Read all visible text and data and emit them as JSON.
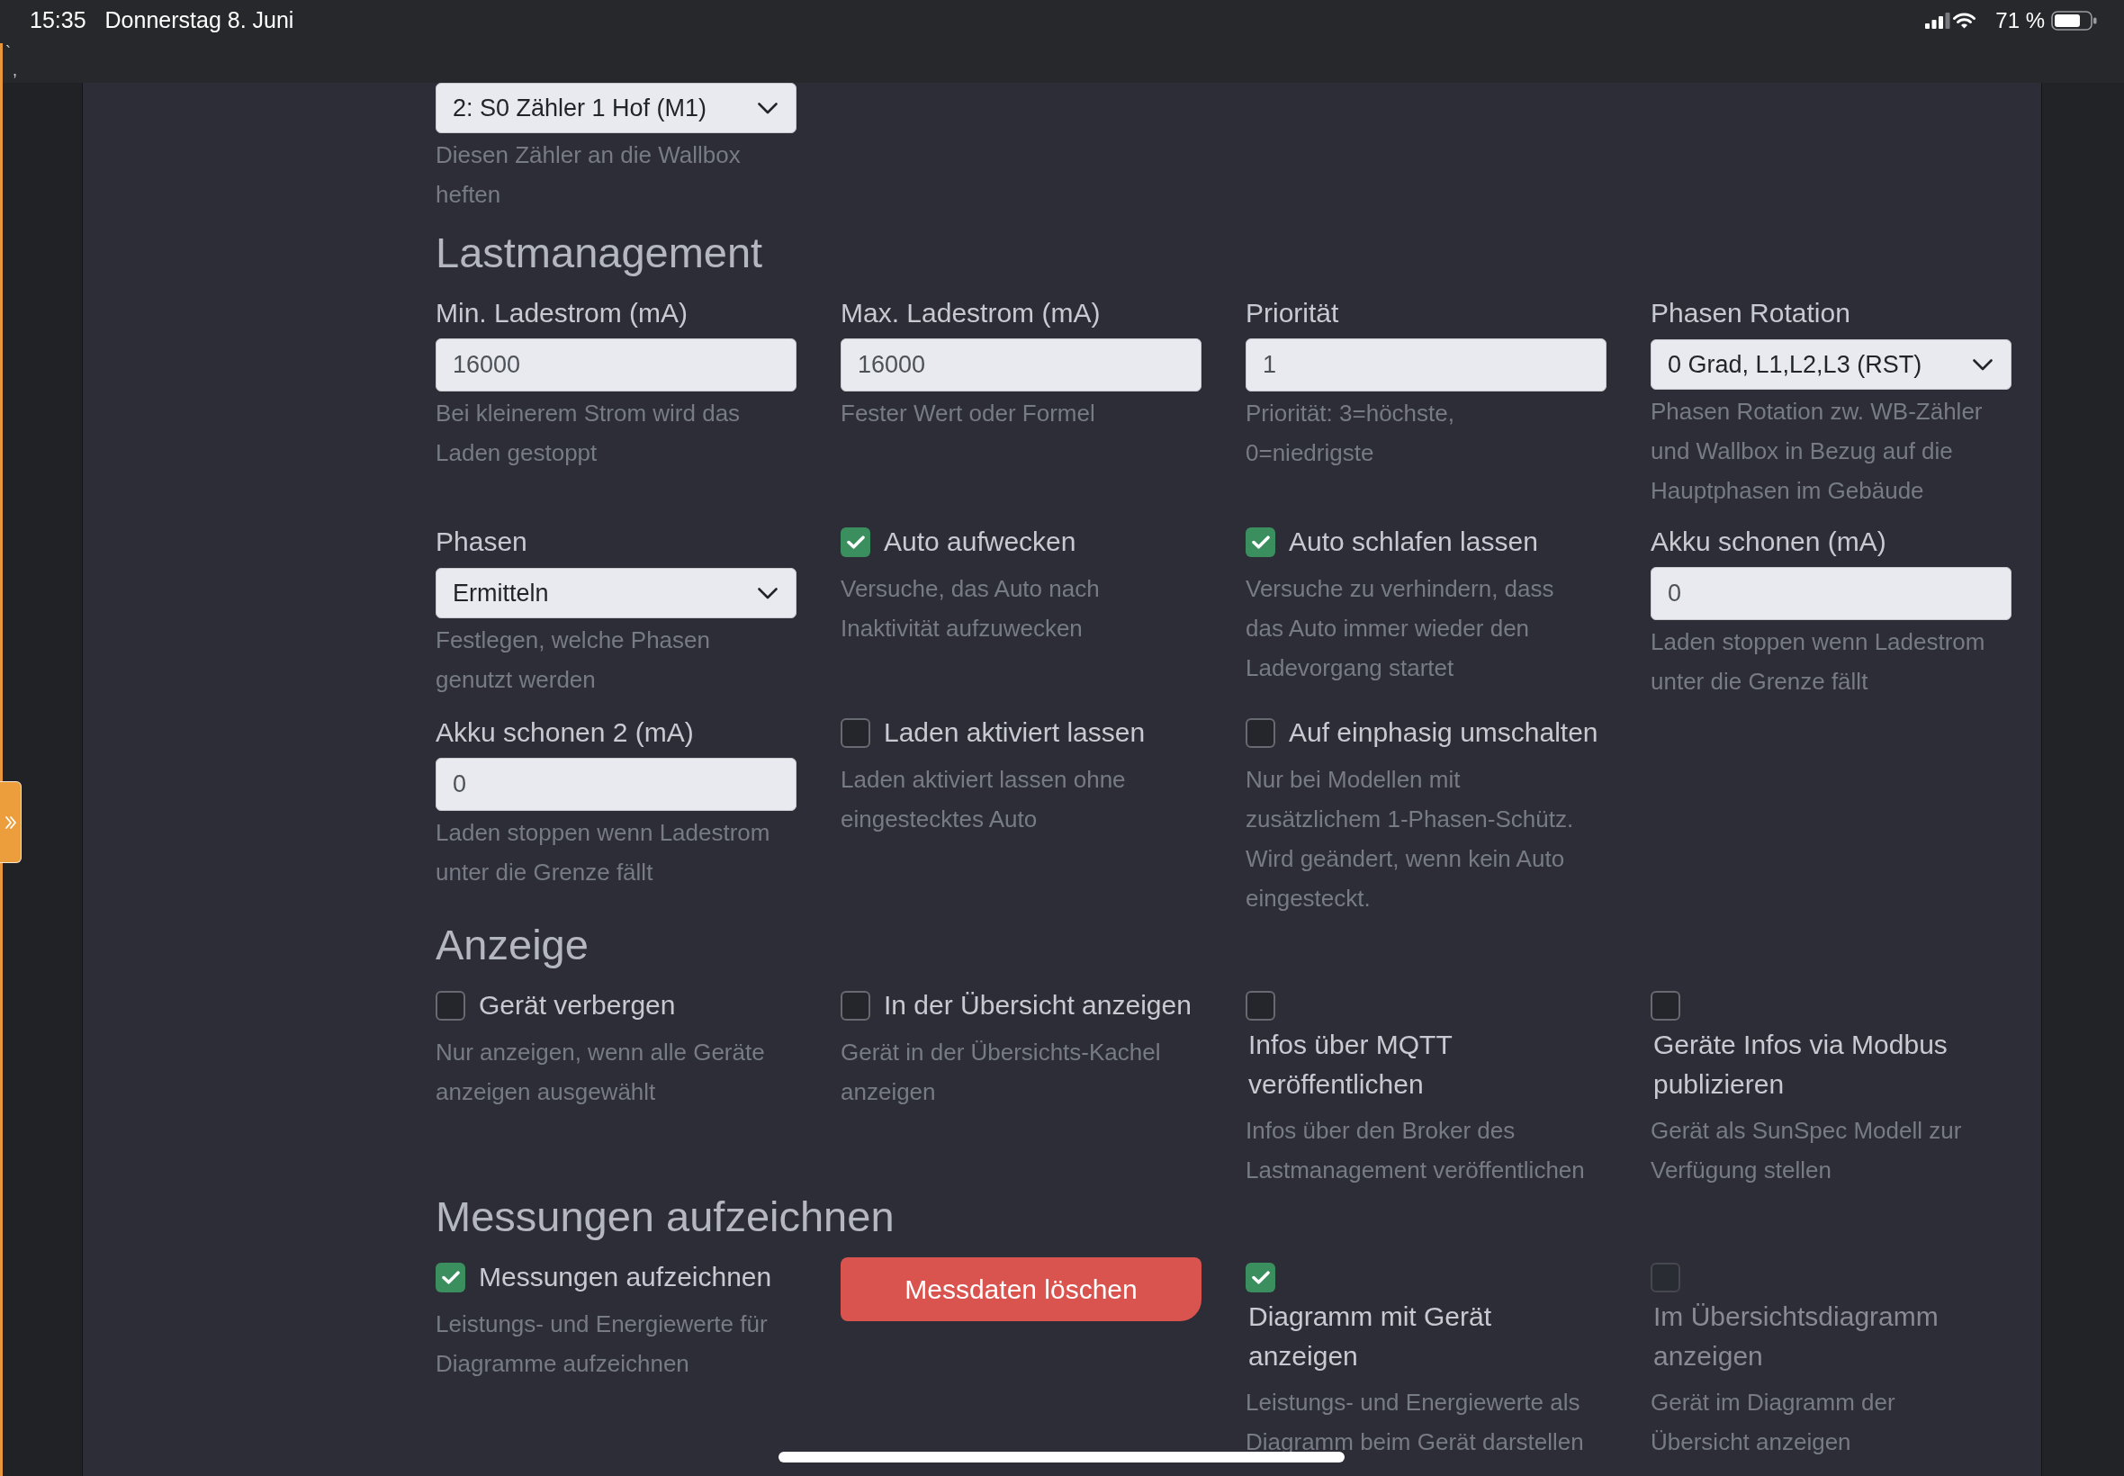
{
  "status_bar": {
    "time": "15:35",
    "date": "Donnerstag 8. Juni",
    "battery": "71 %"
  },
  "stray_marks": [
    "`",
    ","
  ],
  "sections": [
    {
      "rows": [
        [
          {
            "kind": "select",
            "value": "2: S0 Zähler 1 Hof (M1)",
            "help": "Diesen Zähler an die Wallbox heften"
          }
        ]
      ]
    },
    {
      "title": "Lastmanagement",
      "rows": [
        [
          {
            "kind": "input",
            "label": "Min. Ladestrom (mA)",
            "value": "16000",
            "help": "Bei kleinerem Strom wird das Laden gestoppt"
          },
          {
            "kind": "input",
            "label": "Max. Ladestrom (mA)",
            "value": "16000",
            "help": "Fester Wert oder Formel"
          },
          {
            "kind": "input",
            "label": "Priorität",
            "value": "1",
            "help": "Priorität: 3=höchste, 0=niedrigste"
          },
          {
            "kind": "select",
            "label": "Phasen Rotation",
            "value": "0 Grad, L1,L2,L3 (RST)",
            "help": "Phasen Rotation zw. WB-Zähler und Wallbox in Bezug auf die Hauptphasen im Gebäude"
          }
        ],
        [
          {
            "kind": "select",
            "label": "Phasen",
            "value": "Ermitteln",
            "help": "Festlegen, welche Phasen genutzt werden"
          },
          {
            "kind": "checkbox",
            "label": "Auto aufwecken",
            "checked": true,
            "disabled": false,
            "help": "Versuche, das Auto nach Inaktivität aufzuwecken"
          },
          {
            "kind": "checkbox",
            "label": "Auto schlafen lassen",
            "checked": true,
            "disabled": false,
            "help": "Versuche zu verhindern, dass das Auto immer wieder den Ladevorgang startet"
          },
          {
            "kind": "input",
            "label": "Akku schonen (mA)",
            "value": "0",
            "help": "Laden stoppen wenn Ladestrom unter die Grenze fällt"
          }
        ],
        [
          {
            "kind": "input",
            "label": "Akku schonen 2 (mA)",
            "value": "0",
            "help": "Laden stoppen wenn Ladestrom unter die Grenze fällt"
          },
          {
            "kind": "checkbox",
            "label": "Laden aktiviert lassen",
            "checked": false,
            "disabled": false,
            "help": "Laden aktiviert lassen ohne eingestecktes Auto"
          },
          {
            "kind": "checkbox",
            "label": "Auf einphasig umschalten",
            "checked": false,
            "disabled": false,
            "help": "Nur bei Modellen mit zusätzlichem 1-Phasen-Schütz. Wird geändert, wenn kein Auto eingesteckt."
          }
        ]
      ]
    },
    {
      "title": "Anzeige",
      "rows": [
        [
          {
            "kind": "checkbox",
            "label": "Gerät verbergen",
            "checked": false,
            "disabled": false,
            "help": "Nur anzeigen, wenn alle Geräte anzeigen ausgewählt"
          },
          {
            "kind": "checkbox",
            "label": "In der Übersicht anzeigen",
            "checked": false,
            "disabled": false,
            "help": "Gerät in der Übersichts-Kachel anzeigen"
          },
          {
            "kind": "stacked_checkbox",
            "label": "Infos über MQTT veröffentlichen",
            "checked": false,
            "disabled": false,
            "help": "Infos über den Broker des Lastmanagement veröffentlichen"
          },
          {
            "kind": "stacked_checkbox",
            "label": "Geräte Infos via Modbus publizieren",
            "checked": false,
            "disabled": false,
            "help": "Gerät als SunSpec Modell zur Verfügung stellen"
          }
        ]
      ]
    },
    {
      "title": "Messungen aufzeichnen",
      "rows": [
        [
          {
            "kind": "checkbox",
            "label": "Messungen aufzeichnen",
            "checked": true,
            "disabled": false,
            "help": "Leistungs- und Energiewerte für Diagramme aufzeichnen"
          },
          {
            "kind": "button",
            "label": "Messdaten löschen"
          },
          {
            "kind": "stacked_checkbox",
            "label": "Diagramm mit Gerät anzeigen",
            "checked": true,
            "disabled": false,
            "help": "Leistungs- und Energiewerte als Diagramm beim Gerät darstellen"
          },
          {
            "kind": "stacked_checkbox",
            "label": "Im Übersichtsdiagramm anzeigen",
            "checked": false,
            "disabled": true,
            "help": "Gerät im Diagramm der Übersicht anzeigen"
          }
        ]
      ]
    }
  ]
}
